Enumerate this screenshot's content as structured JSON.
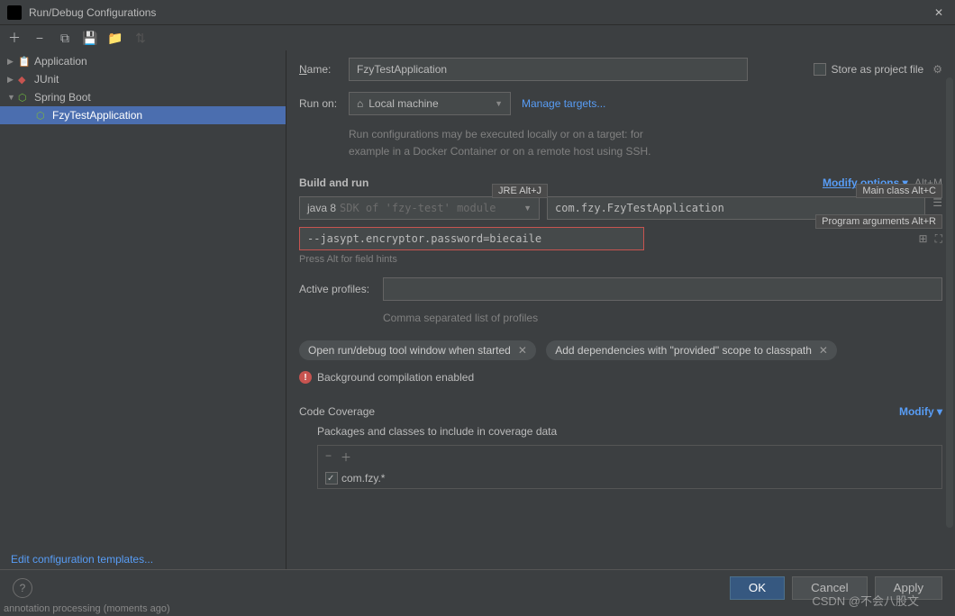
{
  "titlebar": {
    "title": "Run/Debug Configurations"
  },
  "sidebar": {
    "items": [
      {
        "label": "Application"
      },
      {
        "label": "JUnit"
      },
      {
        "label": "Spring Boot"
      },
      {
        "label": "FzyTestApplication"
      }
    ],
    "footer_link": "Edit configuration templates..."
  },
  "form": {
    "name_label": "Name:",
    "name_value": "FzyTestApplication",
    "store_label": "Store as project file",
    "runon_label": "Run on:",
    "runon_value": "Local machine",
    "manage_targets": "Manage targets...",
    "runon_help1": "Run configurations may be executed locally or on a target: for",
    "runon_help2": "example in a Docker Container or on a remote host using SSH."
  },
  "build": {
    "header": "Build and run",
    "modify_options": "Modify options",
    "hint_altm": "Alt+M",
    "hint_jre": "JRE Alt+J",
    "hint_main": "Main class Alt+C",
    "hint_args": "Program arguments Alt+R",
    "jre_value": "java 8",
    "jre_placeholder": "SDK of 'fzy-test' module",
    "main_class": "com.fzy.FzyTestApplication",
    "program_args": "--jasypt.encryptor.password=biecaile",
    "field_hint": "Press Alt for field hints",
    "active_profiles_label": "Active profiles:",
    "active_profiles_help": "Comma separated list of profiles",
    "chip1": "Open run/debug tool window when started",
    "chip2": "Add dependencies with \"provided\" scope to classpath",
    "warn_text": "Background compilation enabled"
  },
  "coverage": {
    "header": "Code Coverage",
    "modify": "Modify",
    "packages_label": "Packages and classes to include in coverage data",
    "item": "com.fzy.*"
  },
  "buttons": {
    "ok": "OK",
    "cancel": "Cancel",
    "apply": "Apply"
  },
  "watermark": "CSDN @不会八股文",
  "status": "annotation processing (moments ago)"
}
